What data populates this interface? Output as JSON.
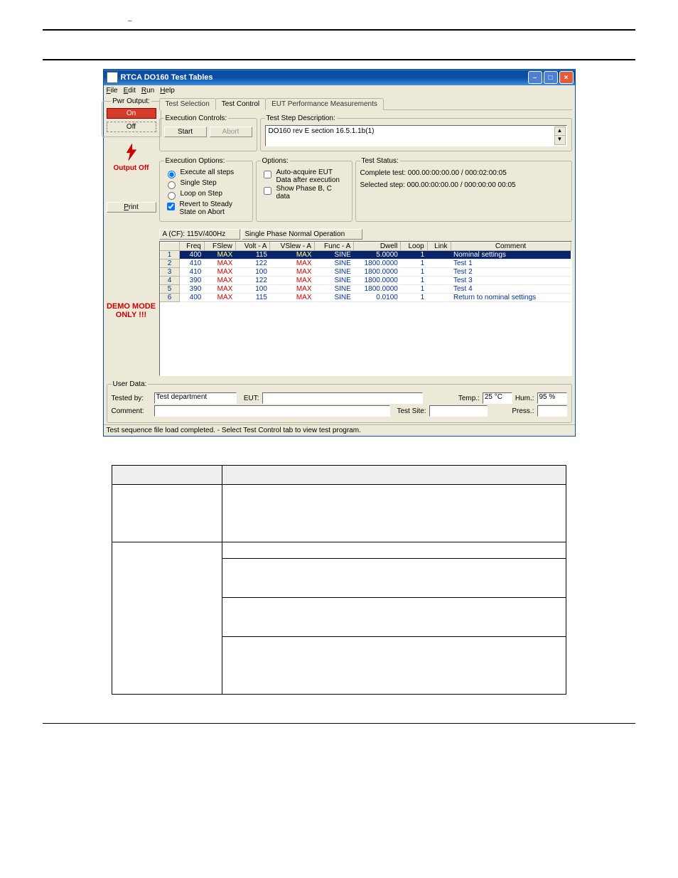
{
  "header_dash": "–",
  "window": {
    "title": "RTCA DO160 Test Tables",
    "menu": {
      "file": "File",
      "edit": "Edit",
      "run": "Run",
      "help": "Help"
    }
  },
  "pwr_output": {
    "legend": "Pwr Output:",
    "on": "On",
    "off": "Off",
    "status": "Output Off",
    "print": "Print",
    "demo1": "DEMO MODE",
    "demo2": "ONLY !!!"
  },
  "tabs": {
    "t1": "Test Selection",
    "t2": "Test Control",
    "t3": "EUT Performance Measurements"
  },
  "exec_controls": {
    "legend": "Execution Controls:",
    "start": "Start",
    "abort": "Abort"
  },
  "desc": {
    "legend": "Test Step Description:",
    "value": "DO160 rev E section 16.5.1.1b(1)"
  },
  "exec_options": {
    "legend": "Execution Options:",
    "opt1": "Execute all steps",
    "opt2": "Single Step",
    "opt3": "Loop on Step",
    "opt4": "Revert to Steady State on Abort"
  },
  "options": {
    "legend": "Options:",
    "opt1": "Auto-acquire EUT Data after execution",
    "opt2": "Show Phase B, C data"
  },
  "status": {
    "legend": "Test Status:",
    "line1": "Complete test:  000.00:00:00.00 / 000:02:00:05",
    "line2": "Selected step:  000.00:00:00.00 / 000:00:00 00:05"
  },
  "grid": {
    "mode": "A (CF): 115V/400Hz",
    "phase": "Single Phase Normal Operation",
    "headers": {
      "freq": "Freq",
      "fslew": "FSlew",
      "volta": "Volt - A",
      "vslewa": "VSlew - A",
      "funca": "Func - A",
      "dwell": "Dwell",
      "loop": "Loop",
      "link": "Link",
      "comment": "Comment"
    },
    "rows": [
      {
        "n": "1",
        "freq": "400",
        "fslew": "MAX",
        "volta": "115",
        "vslewa": "MAX",
        "funca": "SINE",
        "dwell": "5.0000",
        "loop": "1",
        "link": "",
        "comment": "Nominal settings"
      },
      {
        "n": "2",
        "freq": "410",
        "fslew": "MAX",
        "volta": "122",
        "vslewa": "MAX",
        "funca": "SINE",
        "dwell": "1800.0000",
        "loop": "1",
        "link": "",
        "comment": "Test 1"
      },
      {
        "n": "3",
        "freq": "410",
        "fslew": "MAX",
        "volta": "100",
        "vslewa": "MAX",
        "funca": "SINE",
        "dwell": "1800.0000",
        "loop": "1",
        "link": "",
        "comment": "Test 2"
      },
      {
        "n": "4",
        "freq": "390",
        "fslew": "MAX",
        "volta": "122",
        "vslewa": "MAX",
        "funca": "SINE",
        "dwell": "1800.0000",
        "loop": "1",
        "link": "",
        "comment": "Test 3"
      },
      {
        "n": "5",
        "freq": "390",
        "fslew": "MAX",
        "volta": "100",
        "vslewa": "MAX",
        "funca": "SINE",
        "dwell": "1800.0000",
        "loop": "1",
        "link": "",
        "comment": "Test 4"
      },
      {
        "n": "6",
        "freq": "400",
        "fslew": "MAX",
        "volta": "115",
        "vslewa": "MAX",
        "funca": "SINE",
        "dwell": "0.0100",
        "loop": "1",
        "link": "",
        "comment": "Return to nominal settings"
      }
    ]
  },
  "user_data": {
    "legend": "User Data:",
    "tested_by_lbl": "Tested by:",
    "tested_by_val": "Test department",
    "eut_lbl": "EUT:",
    "temp_lbl": "Temp.:",
    "temp_val": "25 °C",
    "hum_lbl": "Hum.:",
    "hum_val": "95 %",
    "comment_lbl": "Comment:",
    "testsite_lbl": "Test Site:",
    "press_lbl": "Press.:"
  },
  "statusbar": "Test sequence file load completed. - Select Test Control tab to view test program."
}
